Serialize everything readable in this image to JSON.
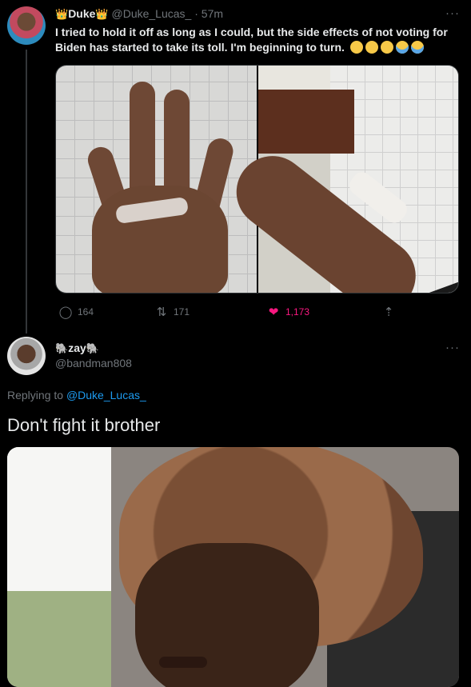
{
  "tweet": {
    "author": {
      "name": "Duke",
      "crown_emoji": "👑",
      "handle": "@Duke_Lucas_",
      "separator": "·",
      "time": "57m"
    },
    "more_label": "···",
    "text": "I tried to hold it off as long as I could, but the side effects of not voting for Biden has started to take its toll. I'm beginning to turn.",
    "emojis": [
      "pensive-face",
      "pensive-face",
      "pensive-face",
      "crying-face",
      "crying-face"
    ],
    "media": [
      {
        "icon": "hand-with-cream-photo"
      },
      {
        "icon": "arm-with-cream-photo"
      }
    ],
    "actions": {
      "replies": "164",
      "retweets": "171",
      "likes": "1,173"
    }
  },
  "reply": {
    "author": {
      "name": "zay",
      "emoji": "🐘",
      "handle": "@bandman808"
    },
    "more_label": "···",
    "replying_prefix": "Replying to ",
    "replying_to": "@Duke_Lucas_",
    "text": "Don't fight it brother",
    "media": {
      "icon": "man-with-wig-photo"
    }
  },
  "colors": {
    "background": "#000000",
    "text": "#e7e9ea",
    "secondary": "#71767b",
    "link": "#1d9bf0",
    "like": "#f91880"
  }
}
